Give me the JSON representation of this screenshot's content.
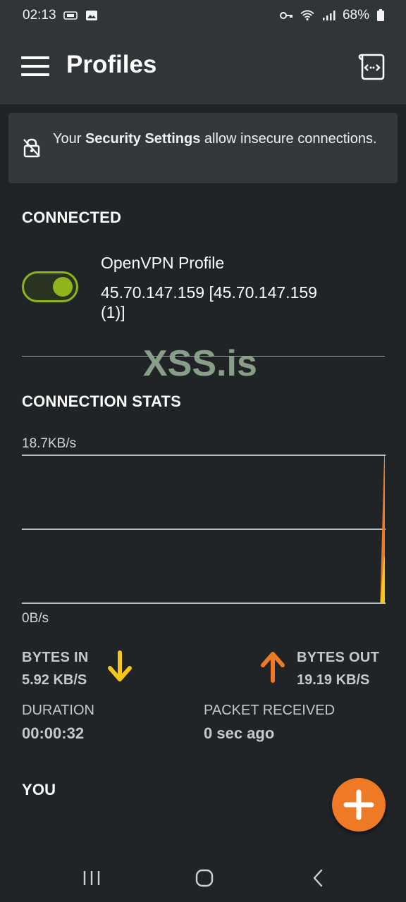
{
  "status_bar": {
    "time": "02:13",
    "battery": "68%",
    "icons": [
      "sim-card-icon",
      "image-icon",
      "key-icon",
      "wifi-icon",
      "signal-icon",
      "battery-icon"
    ]
  },
  "app_bar": {
    "title": "Profiles",
    "menu_icon": "hamburger-menu-icon",
    "import_icon": "import-profile-icon"
  },
  "banner": {
    "text_prefix": "Your ",
    "text_bold": "Security Settings",
    "text_suffix": " allow insecure connections.",
    "icon": "insecure-lock-icon"
  },
  "connected": {
    "heading": "CONNECTED",
    "toggle_on": true,
    "profile_name": "OpenVPN Profile",
    "server": "45.70.147.159 [45.70.147.159 (1)]"
  },
  "watermark": "XSS.is",
  "stats": {
    "heading": "CONNECTION STATS",
    "y_max_label": "18.7KB/s",
    "y_min_label": "0B/s",
    "bytes_in_label": "BYTES IN",
    "bytes_in_value": "5.92 KB/S",
    "bytes_out_label": "BYTES OUT",
    "bytes_out_value": "19.19 KB/S",
    "duration_label": "DURATION",
    "duration_value": "00:00:32",
    "packet_label": "PACKET RECEIVED",
    "packet_value": "0 sec ago"
  },
  "chart_data": {
    "type": "area",
    "x": [
      0,
      1,
      2,
      3,
      4,
      5,
      6,
      7,
      8,
      9,
      10,
      11,
      12,
      13,
      14,
      15,
      16,
      17,
      18,
      19,
      20,
      21,
      22,
      23,
      24,
      25,
      26,
      27,
      28,
      29,
      30,
      31,
      32
    ],
    "series": [
      {
        "values": [
          0,
          0,
          0,
          0,
          0,
          0,
          0,
          0,
          0,
          0,
          0,
          0,
          0,
          0,
          0,
          0,
          0,
          0,
          0,
          0,
          0,
          0,
          0,
          0,
          0,
          0,
          0,
          0,
          0,
          0,
          0,
          0,
          19.19
        ],
        "color": "#ee7a26"
      },
      {
        "values": [
          0,
          0,
          0,
          0,
          0,
          0,
          0,
          0,
          0,
          0,
          0,
          0,
          0,
          0,
          0,
          0,
          0,
          0,
          0,
          0,
          0,
          0,
          0,
          0,
          0,
          0,
          0,
          0,
          0,
          0,
          0,
          0,
          5.92
        ],
        "color": "#f5c518"
      }
    ],
    "ylim": [
      0,
      18.7
    ],
    "y_tick_labels": [
      "18.7KB/s",
      "0B/s"
    ],
    "grid": true
  },
  "you": {
    "heading": "YOU"
  },
  "fab": {
    "icon": "plus-icon"
  },
  "nav": {
    "icons": [
      "recent-apps-icon",
      "home-icon",
      "back-icon"
    ]
  }
}
